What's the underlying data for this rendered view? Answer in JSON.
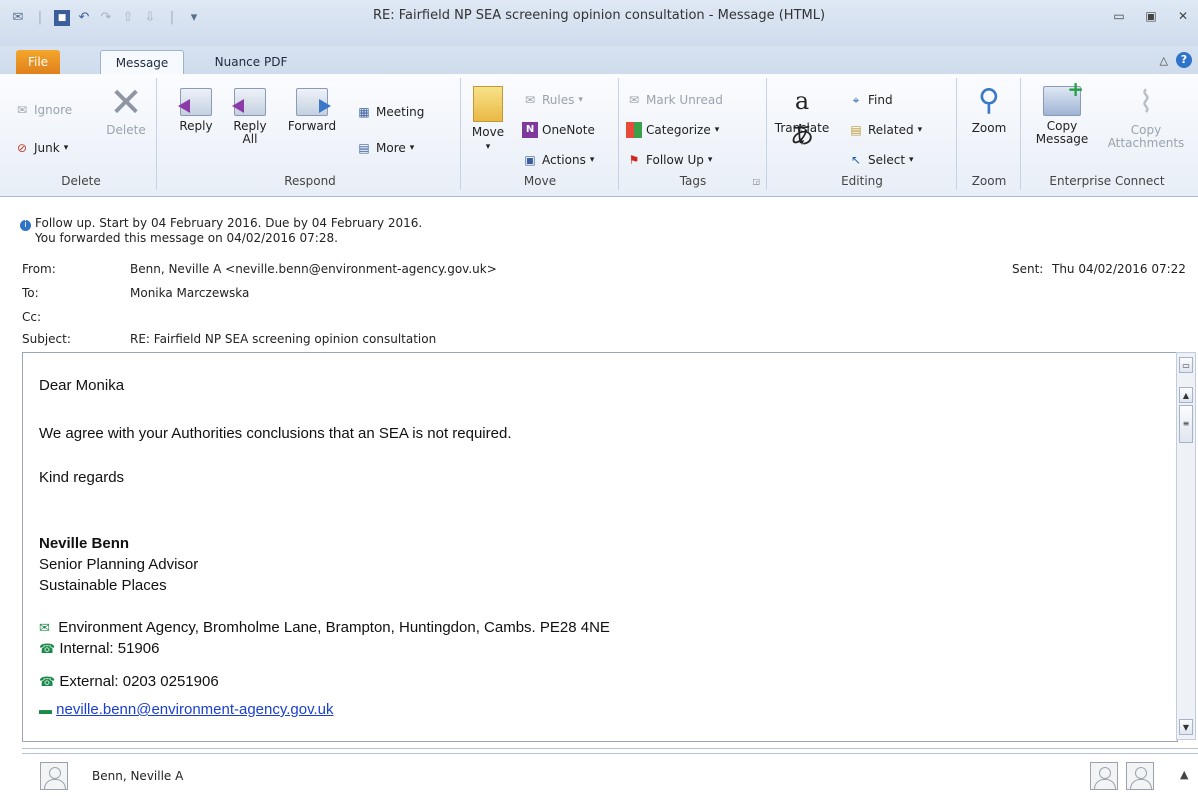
{
  "window": {
    "title": "RE: Fairfield NP SEA screening opinion consultation  -  Message (HTML)"
  },
  "tabs": [
    {
      "label": "File"
    },
    {
      "label": "Message"
    },
    {
      "label": "Nuance PDF"
    }
  ],
  "ribbon": {
    "delete_group": {
      "ignore": "Ignore",
      "junk": "Junk",
      "delete": "Delete",
      "label": "Delete"
    },
    "respond_group": {
      "reply": "Reply",
      "reply_all_1": "Reply",
      "reply_all_2": "All",
      "forward": "Forward",
      "meeting": "Meeting",
      "more": "More",
      "label": "Respond"
    },
    "move_group": {
      "move": "Move",
      "rules": "Rules",
      "onenote": "OneNote",
      "actions": "Actions",
      "label": "Move"
    },
    "tags_group": {
      "mark_unread": "Mark Unread",
      "categorize": "Categorize",
      "follow_up": "Follow Up",
      "label": "Tags"
    },
    "editing_group": {
      "translate": "Translate",
      "find": "Find",
      "related": "Related",
      "select": "Select",
      "label": "Editing"
    },
    "zoom_group": {
      "zoom": "Zoom",
      "label": "Zoom"
    },
    "enterprise_group": {
      "copy_message_1": "Copy",
      "copy_message_2": "Message",
      "copy_attach_1": "Copy",
      "copy_attach_2": "Attachments",
      "label": "Enterprise Connect"
    }
  },
  "info": {
    "line1": "Follow up.  Start by 04 February 2016.  Due by 04 February 2016.",
    "line2": "You forwarded this message on 04/02/2016 07:28."
  },
  "header": {
    "from_label": "From:",
    "from_value": "Benn, Neville A <neville.benn@environment-agency.gov.uk>",
    "sent_label": "Sent:",
    "sent_value": "Thu 04/02/2016 07:22",
    "to_label": "To:",
    "to_value": "Monika Marczewska",
    "cc_label": "Cc:",
    "subject_label": "Subject:",
    "subject_value": "RE: Fairfield NP SEA screening opinion consultation"
  },
  "body": {
    "greeting": "Dear Monika",
    "line1": "We agree with your Authorities conclusions that an SEA is not required.",
    "closing": "Kind regards",
    "sig_name": "Neville Benn",
    "sig_title": "Senior Planning Advisor",
    "sig_team": "Sustainable Places",
    "address": "Environment Agency, Bromholme Lane, Brampton, Huntingdon, Cambs. PE28 4NE",
    "internal": "Internal: 51906",
    "external": "External: 0203 0251906",
    "email": "neville.benn@environment-agency.gov.uk"
  },
  "people": {
    "name": "Benn, Neville A"
  },
  "colors": {
    "file_tab": "#e0801c",
    "link": "#1a3fd0",
    "accent": "#2f74c8"
  }
}
